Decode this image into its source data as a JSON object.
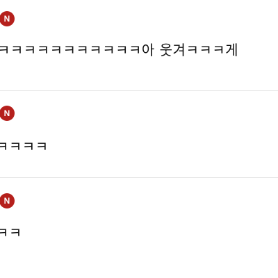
{
  "comments": [
    {
      "badge_label": "N",
      "text": "ㅋㅋㅋㅋㅋㅋㅋㅋㅋㅋㅋ아 웃겨ㅋㅋㅋ게"
    },
    {
      "badge_label": "N",
      "text": "ㅋㅋㅋㅋ"
    },
    {
      "badge_label": "N",
      "text": "ㅋㅋ"
    }
  ],
  "colors": {
    "badge": "#b5201c",
    "divider": "#e6e6e6",
    "text": "#111111",
    "background": "#ffffff"
  }
}
